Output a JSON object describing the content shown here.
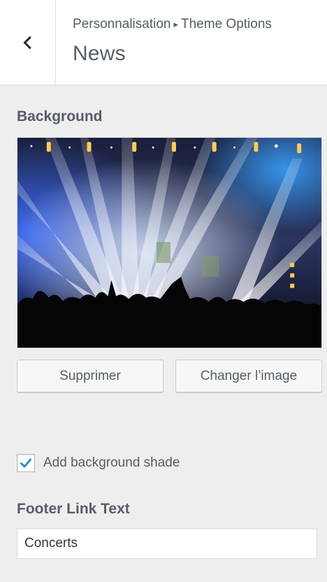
{
  "header": {
    "breadcrumb_root": "Personnalisation",
    "breadcrumb_separator": "▸",
    "breadcrumb_current": "Theme Options",
    "title": "News",
    "back_icon": "chevron-left-icon"
  },
  "background": {
    "label": "Background",
    "image_alt": "concert stage lights with crowd silhouettes",
    "remove_label": "Supprimer",
    "change_label": "Changer l’image"
  },
  "shade": {
    "label": "Add background shade",
    "checked": true,
    "check_color": "#1e8cbe"
  },
  "footer_link": {
    "label": "Footer Link Text",
    "value": "Concerts"
  }
}
